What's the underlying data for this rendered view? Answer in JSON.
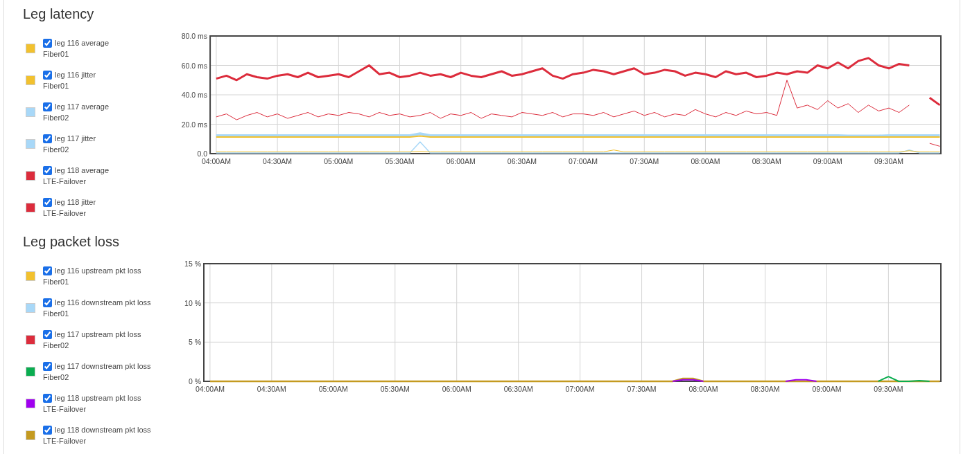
{
  "sections": [
    {
      "title": "Leg latency",
      "legend": [
        {
          "sublabel": "Fiber01",
          "checked": true
        },
        {
          "sublabel": "Fiber01",
          "checked": true
        },
        {
          "sublabel": "Fiber02",
          "checked": true
        },
        {
          "sublabel": "Fiber02",
          "checked": true
        },
        {
          "sublabel": "LTE-Failover",
          "checked": true
        },
        {
          "sublabel": "LTE-Failover",
          "checked": true
        }
      ],
      "chart_data": {
        "type": "line",
        "grid": true,
        "categories": [
          "04:00AM",
          null,
          null,
          null,
          null,
          null,
          "04:30AM",
          null,
          null,
          null,
          null,
          null,
          "05:00AM",
          null,
          null,
          null,
          null,
          null,
          "05:30AM",
          null,
          null,
          null,
          null,
          null,
          "06:00AM",
          null,
          null,
          null,
          null,
          null,
          "06:30AM",
          null,
          null,
          null,
          null,
          null,
          "07:00AM",
          null,
          null,
          null,
          null,
          null,
          "07:30AM",
          null,
          null,
          null,
          null,
          null,
          "08:00AM",
          null,
          null,
          null,
          null,
          null,
          "08:30AM",
          null,
          null,
          null,
          null,
          null,
          "09:00AM",
          null,
          null,
          null,
          null,
          null,
          "09:30AM",
          null,
          null,
          null,
          null,
          null
        ],
        "ylim": [
          0,
          80
        ],
        "yticks": [
          {
            "value": 0,
            "label": "0.0"
          },
          {
            "value": 20,
            "label": "20.0 ms"
          },
          {
            "value": 40,
            "label": "40.0 ms"
          },
          {
            "value": 60,
            "label": "60.0 ms"
          },
          {
            "value": 80,
            "label": "80.0 ms"
          }
        ],
        "series": [
          {
            "name": "leg 116 average",
            "color": "#f2c12e",
            "values": [
              11.3,
              11.3,
              11.3,
              11.3,
              11.3,
              11.3,
              11.3,
              11.3,
              11.3,
              11.3,
              11.3,
              11.3,
              11.3,
              11.3,
              11.3,
              11.3,
              11.3,
              11.3,
              11.3,
              11.3,
              12,
              11.3,
              11.3,
              11.3,
              11.3,
              11.3,
              11.3,
              11.3,
              11.3,
              11.3,
              11.3,
              11.3,
              11.3,
              11.3,
              11.3,
              11.3,
              11.3,
              11.3,
              11.3,
              11.3,
              11.3,
              11.3,
              11.3,
              11.3,
              11.3,
              11.3,
              11.3,
              11.3,
              11.3,
              11.3,
              11.3,
              11.3,
              11.3,
              11.3,
              11.3,
              11.3,
              11.3,
              11.3,
              11.3,
              11.3,
              11.3,
              11.3,
              11.3,
              11.3,
              11.3,
              11.3,
              11.3,
              11.3,
              11.3,
              11.3,
              11.3,
              11.3
            ]
          },
          {
            "name": "leg 116 jitter",
            "color": "#f2c12e",
            "values": [
              1.2,
              1.2,
              1.2,
              1.2,
              1.2,
              1.2,
              1.2,
              1.2,
              1.2,
              1.2,
              1.2,
              1.2,
              1.2,
              1.2,
              1.2,
              1.2,
              1.2,
              1.2,
              1.2,
              1.2,
              1.5,
              1.2,
              1.2,
              1.2,
              1.2,
              1.2,
              1.2,
              1.2,
              1.2,
              1.2,
              1.2,
              1.2,
              1.2,
              1.2,
              1.2,
              1.2,
              1.2,
              1.2,
              1.2,
              2.5,
              1.2,
              1.2,
              1.2,
              1.2,
              1.2,
              1.2,
              1.2,
              1.2,
              1.2,
              1.2,
              1.2,
              1.2,
              1.2,
              1.2,
              1.2,
              1.2,
              1.2,
              1.2,
              1.2,
              1.2,
              1.2,
              1.2,
              1.2,
              1.2,
              1.2,
              1.2,
              1.2,
              1.2,
              2,
              1.2,
              1.2,
              1.2
            ]
          },
          {
            "name": "leg 117 average",
            "color": "#a8d8f8",
            "values": [
              12.3,
              12.3,
              12.3,
              12.3,
              12.3,
              12.3,
              12.3,
              12.3,
              12.3,
              12.3,
              12.3,
              12.3,
              12.3,
              12.3,
              12.3,
              12.3,
              12.3,
              12.3,
              12.3,
              12.3,
              13.5,
              12.3,
              12.3,
              12.3,
              12.3,
              12.3,
              12.3,
              12.3,
              12.3,
              12.3,
              12.3,
              12.3,
              12.3,
              12.3,
              12.3,
              12.3,
              12.3,
              12.3,
              12.3,
              12.3,
              12.3,
              12.3,
              12.3,
              12.3,
              12.3,
              12.3,
              12.3,
              12.3,
              12.3,
              12.3,
              12.3,
              12.3,
              12.3,
              12.3,
              12.3,
              12.3,
              12.3,
              12.3,
              12.3,
              12.3,
              12.3,
              12.3,
              12,
              12,
              12,
              12,
              12.3,
              12.3,
              12.3,
              12.3,
              12.3,
              12.3
            ]
          },
          {
            "name": "leg 117 jitter",
            "color": "#a8d8f8",
            "values": [
              0.5,
              0.5,
              0.5,
              0.5,
              0.5,
              0.5,
              0.5,
              0.5,
              0.5,
              0.5,
              0.5,
              0.5,
              0.5,
              0.5,
              0.5,
              0.5,
              0.5,
              0.5,
              0.5,
              0.5,
              8,
              0.5,
              0.5,
              0.5,
              0.5,
              0.5,
              0.5,
              0.5,
              0.5,
              0.5,
              0.5,
              0.5,
              0.5,
              0.5,
              0.5,
              0.5,
              0.5,
              0.5,
              0.5,
              0.5,
              0.5,
              0.5,
              0.5,
              0.5,
              0.5,
              0.5,
              0.5,
              0.5,
              0.5,
              0.5,
              0.5,
              0.5,
              0.5,
              0.5,
              0.5,
              0.5,
              0.5,
              0.5,
              0.5,
              0.5,
              0.5,
              0.5,
              0.5,
              0.5,
              0.5,
              0.5,
              0.5,
              0.5,
              2.5,
              0.5,
              0.5,
              0.5
            ]
          },
          {
            "name": "leg 118 average",
            "color": "#dc2c3c",
            "values": [
              51,
              53,
              50,
              54,
              52,
              51,
              53,
              54,
              52,
              55,
              52,
              53,
              54,
              52,
              56,
              60,
              54,
              55,
              52,
              53,
              55,
              53,
              54,
              52,
              55,
              53,
              52,
              54,
              56,
              53,
              54,
              56,
              58,
              53,
              51,
              54,
              55,
              57,
              56,
              54,
              56,
              58,
              54,
              55,
              57,
              56,
              53,
              55,
              54,
              52,
              56,
              54,
              55,
              52,
              53,
              55,
              54,
              56,
              55,
              60,
              58,
              62,
              58,
              63,
              65,
              60,
              58,
              61,
              60,
              null,
              38,
              33
            ]
          },
          {
            "name": "leg 118 jitter",
            "color": "#dc2c3c",
            "values": [
              25,
              27,
              23,
              26,
              28,
              25,
              27,
              24,
              26,
              28,
              25,
              27,
              26,
              28,
              27,
              25,
              28,
              26,
              27,
              25,
              26,
              28,
              24,
              27,
              26,
              28,
              24,
              27,
              26,
              25,
              28,
              27,
              26,
              28,
              25,
              27,
              27,
              26,
              28,
              25,
              27,
              29,
              26,
              28,
              25,
              27,
              26,
              30,
              27,
              25,
              28,
              26,
              29,
              27,
              28,
              26,
              50,
              31,
              33,
              30,
              36,
              31,
              34,
              28,
              33,
              29,
              31,
              28,
              33,
              null,
              7,
              5
            ]
          }
        ]
      }
    },
    {
      "title": "Leg packet loss",
      "legend": [
        {
          "sublabel": "Fiber01",
          "checked": true
        },
        {
          "sublabel": "Fiber01",
          "checked": true
        },
        {
          "sublabel": "Fiber02",
          "checked": true
        },
        {
          "sublabel": "Fiber02",
          "checked": true
        },
        {
          "sublabel": "LTE-Failover",
          "checked": true
        },
        {
          "sublabel": "LTE-Failover",
          "checked": true
        }
      ],
      "chart_data": {
        "type": "line",
        "grid": true,
        "categories": [
          "04:00AM",
          null,
          null,
          null,
          null,
          null,
          "04:30AM",
          null,
          null,
          null,
          null,
          null,
          "05:00AM",
          null,
          null,
          null,
          null,
          null,
          "05:30AM",
          null,
          null,
          null,
          null,
          null,
          "06:00AM",
          null,
          null,
          null,
          null,
          null,
          "06:30AM",
          null,
          null,
          null,
          null,
          null,
          "07:00AM",
          null,
          null,
          null,
          null,
          null,
          "07:30AM",
          null,
          null,
          null,
          null,
          null,
          "08:00AM",
          null,
          null,
          null,
          null,
          null,
          "08:30AM",
          null,
          null,
          null,
          null,
          null,
          "09:00AM",
          null,
          null,
          null,
          null,
          null,
          "09:30AM",
          null,
          null,
          null,
          null,
          null
        ],
        "ylim": [
          0,
          15
        ],
        "yticks": [
          {
            "value": 0,
            "label": "0 %"
          },
          {
            "value": 5,
            "label": "5 %"
          },
          {
            "value": 10,
            "label": "10 %"
          },
          {
            "value": 15,
            "label": "15 %"
          }
        ],
        "series": [
          {
            "name": "leg 116 upstream pkt loss",
            "color": "#f2c12e",
            "values": [
              null,
              null,
              null,
              null,
              null,
              null,
              null,
              null,
              null,
              null,
              null,
              null,
              null,
              null,
              null,
              null,
              null,
              null,
              null,
              null,
              null,
              null,
              null,
              null,
              null,
              null,
              null,
              null,
              null,
              null,
              null,
              null,
              null,
              null,
              null,
              null,
              null,
              null,
              null,
              null,
              null,
              null,
              null,
              null,
              null,
              null,
              null,
              null,
              null,
              null,
              null,
              null,
              null,
              null,
              null,
              null,
              null,
              null,
              null,
              null,
              null,
              null,
              null,
              null,
              null,
              null,
              null,
              null,
              null,
              null,
              null,
              null
            ]
          },
          {
            "name": "leg 116 downstream pkt loss",
            "color": "#a8d8f8",
            "values": [
              null,
              null,
              null,
              null,
              null,
              null,
              null,
              null,
              null,
              null,
              null,
              null,
              null,
              null,
              null,
              null,
              null,
              null,
              null,
              null,
              null,
              null,
              null,
              null,
              null,
              null,
              null,
              null,
              null,
              null,
              null,
              null,
              null,
              null,
              null,
              null,
              null,
              null,
              null,
              null,
              null,
              null,
              null,
              null,
              null,
              null,
              null,
              null,
              null,
              null,
              null,
              null,
              null,
              null,
              null,
              null,
              null,
              null,
              null,
              null,
              null,
              null,
              null,
              null,
              null,
              null,
              null,
              null,
              null,
              null,
              null,
              null
            ]
          },
          {
            "name": "leg 117 upstream pkt loss",
            "color": "#dc2c3c",
            "values": [
              null,
              null,
              null,
              null,
              null,
              null,
              null,
              null,
              null,
              null,
              null,
              null,
              null,
              null,
              null,
              null,
              null,
              null,
              null,
              null,
              null,
              null,
              null,
              null,
              null,
              null,
              null,
              null,
              null,
              null,
              null,
              null,
              null,
              null,
              null,
              null,
              null,
              null,
              null,
              null,
              null,
              null,
              null,
              null,
              null,
              null,
              null,
              null,
              null,
              null,
              null,
              null,
              null,
              null,
              null,
              null,
              null,
              null,
              null,
              null,
              null,
              null,
              null,
              null,
              null,
              null,
              null,
              null,
              null,
              null,
              null,
              null
            ]
          },
          {
            "name": "leg 117 downstream pkt loss",
            "color": "#0aad50",
            "values": [
              null,
              null,
              null,
              null,
              null,
              null,
              null,
              null,
              null,
              null,
              null,
              null,
              null,
              null,
              null,
              null,
              null,
              null,
              null,
              null,
              null,
              null,
              null,
              null,
              null,
              null,
              null,
              null,
              null,
              null,
              null,
              null,
              null,
              null,
              null,
              null,
              null,
              null,
              null,
              null,
              null,
              null,
              null,
              null,
              null,
              null,
              null,
              null,
              null,
              null,
              null,
              null,
              null,
              null,
              null,
              null,
              null,
              null,
              null,
              null,
              null,
              null,
              null,
              null,
              null,
              0,
              0.6,
              0,
              0,
              0.1,
              0,
              null
            ]
          },
          {
            "name": "leg 118 upstream pkt loss",
            "color": "#a000f0",
            "values": [
              null,
              null,
              null,
              null,
              null,
              null,
              null,
              null,
              null,
              null,
              null,
              null,
              null,
              null,
              null,
              null,
              null,
              null,
              null,
              null,
              null,
              null,
              null,
              null,
              null,
              null,
              null,
              null,
              null,
              null,
              null,
              null,
              null,
              null,
              null,
              null,
              null,
              null,
              null,
              null,
              null,
              null,
              null,
              null,
              null,
              0,
              0.2,
              0.2,
              0,
              null,
              null,
              null,
              null,
              null,
              null,
              null,
              0,
              0.2,
              0.2,
              0,
              null,
              null,
              null,
              null,
              null,
              null,
              null,
              null,
              null,
              null,
              null,
              null
            ]
          },
          {
            "name": "leg 118 downstream pkt loss",
            "color": "#c49a20",
            "values": [
              0,
              0,
              0,
              0,
              0,
              0,
              0,
              0,
              0,
              0,
              0,
              0,
              0,
              0,
              0,
              0,
              0,
              0,
              0,
              0,
              0,
              0,
              0,
              0,
              0,
              0,
              0,
              0,
              0,
              0,
              0,
              0,
              0,
              0,
              0,
              0,
              0,
              0,
              0,
              0,
              0,
              0,
              0,
              0,
              0,
              0,
              0.35,
              0.35,
              0,
              0,
              0,
              0,
              0,
              0,
              0,
              0,
              0,
              0,
              0,
              0,
              0,
              0,
              0,
              0,
              0,
              0,
              0,
              0,
              0,
              0,
              0,
              0
            ]
          }
        ]
      }
    }
  ]
}
